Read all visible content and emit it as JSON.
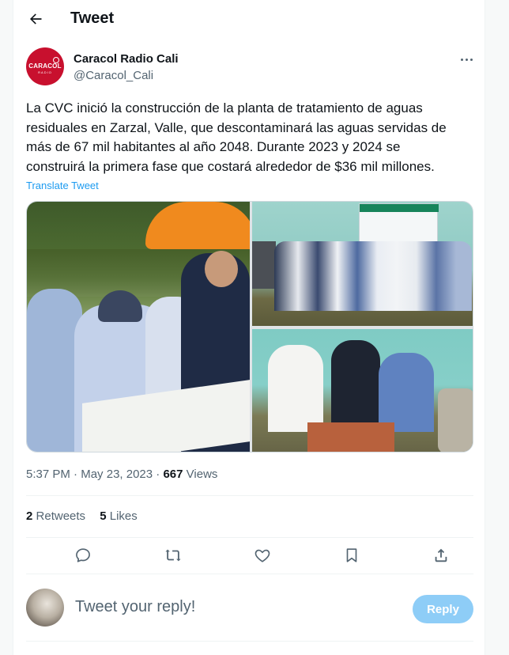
{
  "header": {
    "title": "Tweet",
    "back_icon": "arrow-left-icon"
  },
  "author": {
    "name": "Caracol Radio Cali",
    "handle": "@Caracol_Cali",
    "avatar_text": "CARACOL",
    "avatar_subtext": "RADIO",
    "avatar_color": "#c8102e"
  },
  "tweet": {
    "text": "La CVC inició la construcción de la planta de tratamiento de aguas\nresiduales en Zarzal, Valle, que descontaminará las aguas servidas de\nmás de 67 mil habitantes al año 2048. Durante 2023 y 2024 se\nconstruirá la primera fase que  costará alrededor de $36 mil millones.",
    "translate_label": "Translate Tweet",
    "time": "5:37 PM",
    "separator": "·",
    "date": "May 23, 2023",
    "views_count": "667",
    "views_label": "Views"
  },
  "stats": {
    "retweets_count": "2",
    "retweets_label": "Retweets",
    "likes_count": "5",
    "likes_label": "Likes"
  },
  "actions": [
    {
      "name": "reply-icon"
    },
    {
      "name": "retweet-icon"
    },
    {
      "name": "like-icon"
    },
    {
      "name": "bookmark-icon"
    },
    {
      "name": "share-icon"
    }
  ],
  "reply_box": {
    "placeholder": "Tweet your reply!",
    "button_label": "Reply",
    "button_color": "#8ecdf7"
  },
  "colors": {
    "accent": "#1d9bf0",
    "secondary_text": "#536471"
  }
}
